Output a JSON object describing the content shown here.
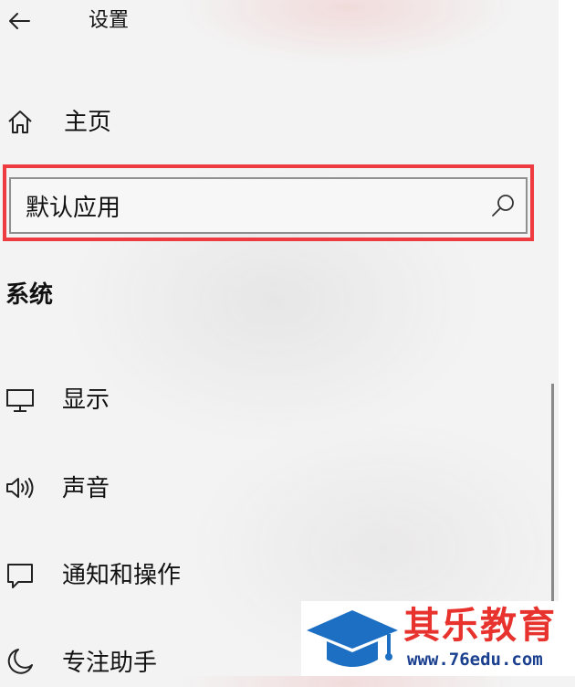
{
  "header": {
    "title": "设置",
    "back_icon": "arrow-left-icon"
  },
  "nav": {
    "home": {
      "label": "主页",
      "icon": "home-icon"
    }
  },
  "search": {
    "value": "默认应用",
    "icon": "search-icon"
  },
  "highlight": {
    "color": "#ee3b3f"
  },
  "section": {
    "title": "系统"
  },
  "menu": {
    "items": [
      {
        "label": "显示",
        "icon": "monitor-icon"
      },
      {
        "label": "声音",
        "icon": "speaker-icon"
      },
      {
        "label": "通知和操作",
        "icon": "notification-icon"
      },
      {
        "label": "专注助手",
        "icon": "moon-icon"
      }
    ]
  },
  "watermark": {
    "brand": "其乐教育",
    "url": "www.76edu.com",
    "icon": "graduation-cap-icon",
    "brand_color": "#e8322e",
    "icon_color": "#1d6fc4"
  }
}
